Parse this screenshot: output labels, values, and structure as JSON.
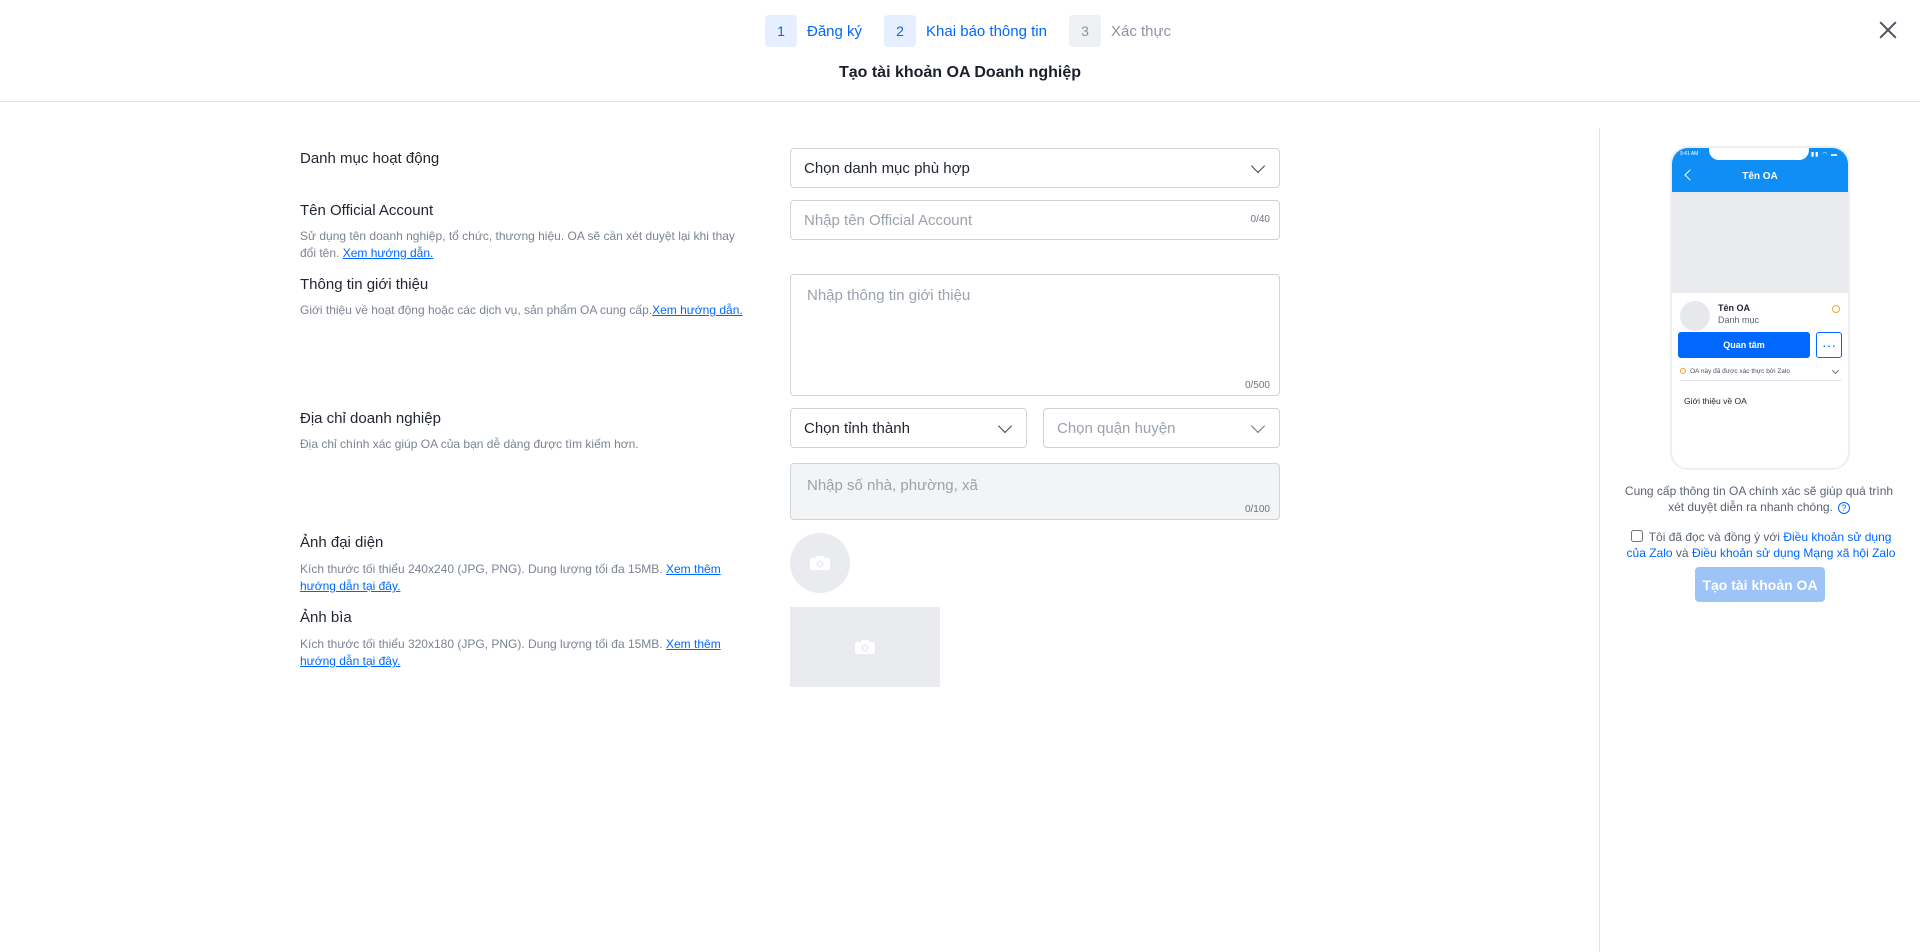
{
  "header": {
    "steps": [
      {
        "number": "1",
        "label": "Đăng ký"
      },
      {
        "number": "2",
        "label": "Khai báo thông tin"
      },
      {
        "number": "3",
        "label": "Xác thực"
      }
    ],
    "title": "Tạo tài khoản OA Doanh nghiệp"
  },
  "form": {
    "category": {
      "label": "Danh mục hoạt động",
      "value": "Chọn danh mục phù hợp"
    },
    "oa_name": {
      "label": "Tên Official Account",
      "description": "Sử dụng tên doanh nghiệp, tổ chức, thương hiệu. OA sẽ cần xét duyệt lại khi thay đổi tên.",
      "link": "Xem hướng dẫn.",
      "placeholder": "Nhập tên Official Account",
      "counter": "0/40"
    },
    "intro": {
      "label": "Thông tin giới thiệu",
      "description": "Giới thiệu về hoạt động hoặc các dịch vụ, sản phẩm OA cung cấp.",
      "link": "Xem hướng dẫn.",
      "placeholder": "Nhập thông tin giới thiệu",
      "counter": "0/500"
    },
    "address": {
      "label": "Địa chỉ doanh nghiệp",
      "description": "Địa chỉ chính xác giúp OA của bạn dễ dàng được tìm kiếm hơn.",
      "province": "Chọn tỉnh thành",
      "district": "Chọn quận huyện",
      "street_placeholder": "Nhập số nhà, phường, xã",
      "counter": "0/100"
    },
    "avatar": {
      "label": "Ảnh đại diện",
      "description": "Kích thước tối thiểu 240x240 (JPG, PNG). Dung lượng tối đa 15MB.",
      "link": "Xem thêm hướng dẫn tại đây."
    },
    "cover": {
      "label": "Ảnh bìa",
      "description": "Kích thước tối thiểu 320x180 (JPG, PNG). Dung lượng tối đa 15MB.",
      "link": "Xem thêm hướng dẫn tại đây."
    }
  },
  "preview": {
    "status_time": "9:41 AM",
    "status_icons": "▮▮ ◠ ▬",
    "title": "Tên OA",
    "oa_name": "Tên OA",
    "oa_category": "Danh mục",
    "follow_label": "Quan tâm",
    "more_label": "···",
    "verified_text": "OA này đã được xác thực bởi Zalo",
    "intro_text": "Giới thiệu về OA"
  },
  "sidebar": {
    "hint": "Cung cấp thông tin OA chính xác sẽ giúp quá trình xét duyệt diễn ra nhanh chóng.",
    "help_icon": "?",
    "terms_prefix": "Tôi đã đọc và đồng ý với",
    "terms_link1": "Điều khoản sử dụng của Zalo",
    "terms_and": "và",
    "terms_link2": "Điều khoản sử dụng Mạng xã hội Zalo",
    "submit_label": "Tạo tài khoản OA"
  },
  "colors": {
    "accent": "#0068ff",
    "phone_header": "#0f8ff5",
    "submit_disabled": "#9ec3f7",
    "badge": "#f5a623"
  }
}
